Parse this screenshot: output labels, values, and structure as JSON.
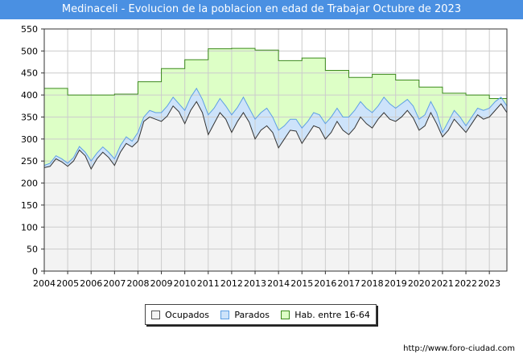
{
  "header": {
    "title": "Medinaceli - Evolucion de la poblacion en edad de Trabajar Octubre de 2023"
  },
  "footer": {
    "url": "http://www.foro-ciudad.com"
  },
  "legend": {
    "ocupados": "Ocupados",
    "parados": "Parados",
    "hab": "Hab. entre 16-64"
  },
  "colors": {
    "ocupados_fill": "#f3f3f3",
    "parados_fill": "#cde3fa",
    "hab_fill": "#ddffc6",
    "hab_line": "#3c8a1d",
    "line_dark": "#333333",
    "parados_line": "#5d9fe4",
    "grid": "#cccccc"
  },
  "chart_data": {
    "type": "area",
    "title": "Medinaceli - Evolucion de la poblacion en edad de Trabajar Octubre de 2023",
    "xlabel": "",
    "ylabel": "",
    "xlim": [
      2004,
      2023.75
    ],
    "ylim": [
      0,
      550
    ],
    "yticks": [
      0,
      50,
      100,
      150,
      200,
      250,
      300,
      350,
      400,
      450,
      500,
      550
    ],
    "xticks": [
      "2004",
      "2005",
      "2006",
      "2007",
      "2008",
      "2009",
      "2010",
      "2011",
      "2012",
      "2013",
      "2014",
      "2015",
      "2016",
      "2017",
      "2018",
      "2019",
      "2020",
      "2021",
      "2022",
      "2023"
    ],
    "grid": true,
    "legend_position": "bottom",
    "series": [
      {
        "name": "Hab. entre 16-64",
        "step": true,
        "x": [
          2004,
          2005,
          2006,
          2007,
          2008,
          2009,
          2010,
          2011,
          2012,
          2013,
          2014,
          2015,
          2016,
          2017,
          2018,
          2019,
          2020,
          2021,
          2022,
          2023
        ],
        "values": [
          415,
          400,
          400,
          402,
          430,
          460,
          480,
          505,
          506,
          502,
          478,
          484,
          456,
          440,
          447,
          434,
          418,
          404,
          400,
          392
        ]
      },
      {
        "name": "Parados",
        "x": [
          2004,
          2004.25,
          2004.5,
          2004.75,
          2005,
          2005.25,
          2005.5,
          2005.75,
          2006,
          2006.25,
          2006.5,
          2006.75,
          2007,
          2007.25,
          2007.5,
          2007.75,
          2008,
          2008.25,
          2008.5,
          2008.75,
          2009,
          2009.25,
          2009.5,
          2009.75,
          2010,
          2010.25,
          2010.5,
          2010.75,
          2011,
          2011.25,
          2011.5,
          2011.75,
          2012,
          2012.25,
          2012.5,
          2012.75,
          2013,
          2013.25,
          2013.5,
          2013.75,
          2014,
          2014.25,
          2014.5,
          2014.75,
          2015,
          2015.25,
          2015.5,
          2015.75,
          2016,
          2016.25,
          2016.5,
          2016.75,
          2017,
          2017.25,
          2017.5,
          2017.75,
          2018,
          2018.25,
          2018.5,
          2018.75,
          2019,
          2019.25,
          2019.5,
          2019.75,
          2020,
          2020.25,
          2020.5,
          2020.75,
          2021,
          2021.25,
          2021.5,
          2021.75,
          2022,
          2022.25,
          2022.5,
          2022.75,
          2023,
          2023.25,
          2023.5,
          2023.75
        ],
        "values": [
          240,
          245,
          262,
          255,
          245,
          258,
          283,
          270,
          250,
          268,
          282,
          270,
          255,
          285,
          305,
          295,
          315,
          350,
          365,
          360,
          360,
          375,
          395,
          380,
          365,
          395,
          415,
          390,
          355,
          370,
          392,
          375,
          355,
          372,
          395,
          370,
          345,
          360,
          370,
          350,
          320,
          330,
          345,
          345,
          325,
          340,
          360,
          355,
          335,
          350,
          370,
          350,
          350,
          365,
          385,
          370,
          360,
          375,
          395,
          380,
          370,
          380,
          390,
          375,
          345,
          355,
          385,
          360,
          315,
          340,
          365,
          350,
          330,
          350,
          370,
          365,
          370,
          385,
          395,
          375
        ]
      },
      {
        "name": "Ocupados",
        "x": [
          2004,
          2004.25,
          2004.5,
          2004.75,
          2005,
          2005.25,
          2005.5,
          2005.75,
          2006,
          2006.25,
          2006.5,
          2006.75,
          2007,
          2007.25,
          2007.5,
          2007.75,
          2008,
          2008.25,
          2008.5,
          2008.75,
          2009,
          2009.25,
          2009.5,
          2009.75,
          2010,
          2010.25,
          2010.5,
          2010.75,
          2011,
          2011.25,
          2011.5,
          2011.75,
          2012,
          2012.25,
          2012.5,
          2012.75,
          2013,
          2013.25,
          2013.5,
          2013.75,
          2014,
          2014.25,
          2014.5,
          2014.75,
          2015,
          2015.25,
          2015.5,
          2015.75,
          2016,
          2016.25,
          2016.5,
          2016.75,
          2017,
          2017.25,
          2017.5,
          2017.75,
          2018,
          2018.25,
          2018.5,
          2018.75,
          2019,
          2019.25,
          2019.5,
          2019.75,
          2020,
          2020.25,
          2020.5,
          2020.75,
          2021,
          2021.25,
          2021.5,
          2021.75,
          2022,
          2022.25,
          2022.5,
          2022.75,
          2023,
          2023.25,
          2023.5,
          2023.75
        ],
        "values": [
          235,
          238,
          255,
          248,
          238,
          250,
          275,
          262,
          232,
          255,
          270,
          258,
          240,
          270,
          290,
          282,
          295,
          340,
          350,
          345,
          340,
          352,
          375,
          362,
          335,
          365,
          385,
          360,
          310,
          335,
          360,
          345,
          315,
          340,
          360,
          338,
          300,
          320,
          330,
          315,
          280,
          300,
          320,
          318,
          290,
          310,
          330,
          325,
          300,
          315,
          340,
          320,
          310,
          325,
          350,
          335,
          325,
          345,
          360,
          345,
          340,
          350,
          365,
          348,
          320,
          330,
          360,
          335,
          305,
          320,
          345,
          330,
          315,
          335,
          355,
          345,
          350,
          365,
          380,
          360
        ]
      }
    ]
  }
}
